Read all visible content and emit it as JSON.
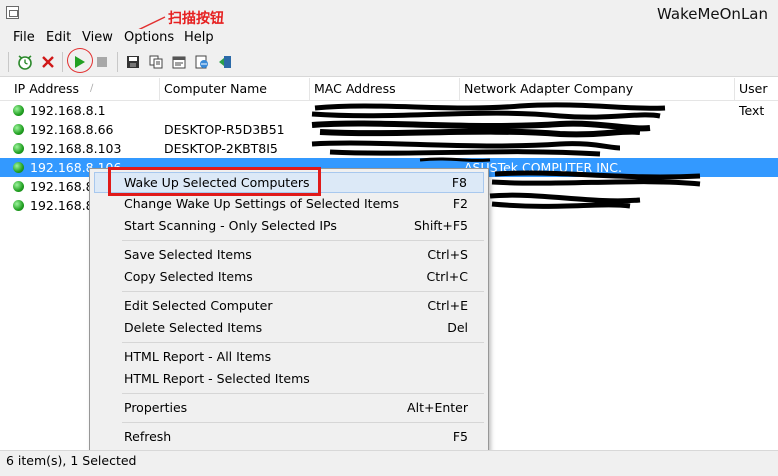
{
  "app": {
    "title": "WakeMeOnLan"
  },
  "annotation": {
    "text": "扫描按钮",
    "color": "#e62020"
  },
  "menubar": {
    "items": [
      "File",
      "Edit",
      "View",
      "Options",
      "Help"
    ]
  },
  "toolbar": {
    "buttons": [
      "wake-icon",
      "delete-icon",
      "start-scan-icon",
      "stop-scan-icon",
      "save-icon",
      "copy-icon",
      "properties-icon",
      "html-report-icon",
      "exit-icon"
    ]
  },
  "columns": [
    "IP Address",
    "Computer Name",
    "MAC Address",
    "Network Adapter Company",
    "User Text"
  ],
  "rows": [
    {
      "ip": "192.168.8.1",
      "name": "",
      "company": "",
      "selected": false
    },
    {
      "ip": "192.168.8.66",
      "name": "DESKTOP-R5D3B51",
      "company": "",
      "selected": false
    },
    {
      "ip": "192.168.8.103",
      "name": "DESKTOP-2KBT8I5",
      "company": "",
      "selected": false
    },
    {
      "ip": "192.168.8.106",
      "name": "",
      "company": "ASUSTek COMPUTER INC.",
      "selected": true
    },
    {
      "ip": "192.168.8.1",
      "name": "",
      "company": "",
      "selected": false
    },
    {
      "ip": "192.168.8.1",
      "name": "",
      "company": "",
      "selected": false
    }
  ],
  "context_menu": {
    "groups": [
      [
        {
          "label": "Wake Up Selected Computers",
          "shortcut": "F8"
        },
        {
          "label": "Change Wake Up Settings of Selected Items",
          "shortcut": "F2"
        },
        {
          "label": "Start Scanning - Only Selected IPs",
          "shortcut": "Shift+F5"
        }
      ],
      [
        {
          "label": "Save Selected Items",
          "shortcut": "Ctrl+S"
        },
        {
          "label": "Copy Selected Items",
          "shortcut": "Ctrl+C"
        }
      ],
      [
        {
          "label": "Edit Selected Computer",
          "shortcut": "Ctrl+E"
        },
        {
          "label": "Delete Selected Items",
          "shortcut": "Del"
        }
      ],
      [
        {
          "label": "HTML Report - All Items",
          "shortcut": ""
        },
        {
          "label": "HTML Report - Selected Items",
          "shortcut": ""
        }
      ],
      [
        {
          "label": "Properties",
          "shortcut": "Alt+Enter"
        }
      ],
      [
        {
          "label": "Refresh",
          "shortcut": "F5"
        }
      ]
    ]
  },
  "status": {
    "text": "6 item(s), 1 Selected"
  }
}
